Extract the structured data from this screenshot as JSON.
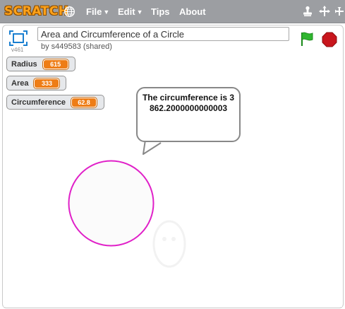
{
  "menubar": {
    "logo": "SCRATCH",
    "file_label": "File",
    "edit_label": "Edit",
    "tips_label": "Tips",
    "about_label": "About"
  },
  "project": {
    "title": "Area and Circumference of a Circle",
    "byline": "by s449583 (shared)",
    "version": "v461"
  },
  "monitors": {
    "radius": {
      "label": "Radius",
      "value": "615"
    },
    "area": {
      "label": "Area",
      "value": "333"
    },
    "circumference": {
      "label": "Circumference",
      "value": "62.8"
    }
  },
  "speech_bubble": {
    "text": "The circumference is 3862.2000000000003"
  },
  "colors": {
    "menubar": "#9c9ea2",
    "monitor_value": "#ee7d16",
    "circle_stroke": "#e020c8",
    "green_flag": "#2fb62f",
    "stop": "#c8161d"
  },
  "icons": {
    "globe": "globe-icon",
    "stamp": "stamp-icon",
    "grow": "grow-icon",
    "shrink": "shrink-icon",
    "fullscreen": "fullscreen-icon",
    "green_flag": "green-flag-icon",
    "stop": "stop-icon"
  }
}
